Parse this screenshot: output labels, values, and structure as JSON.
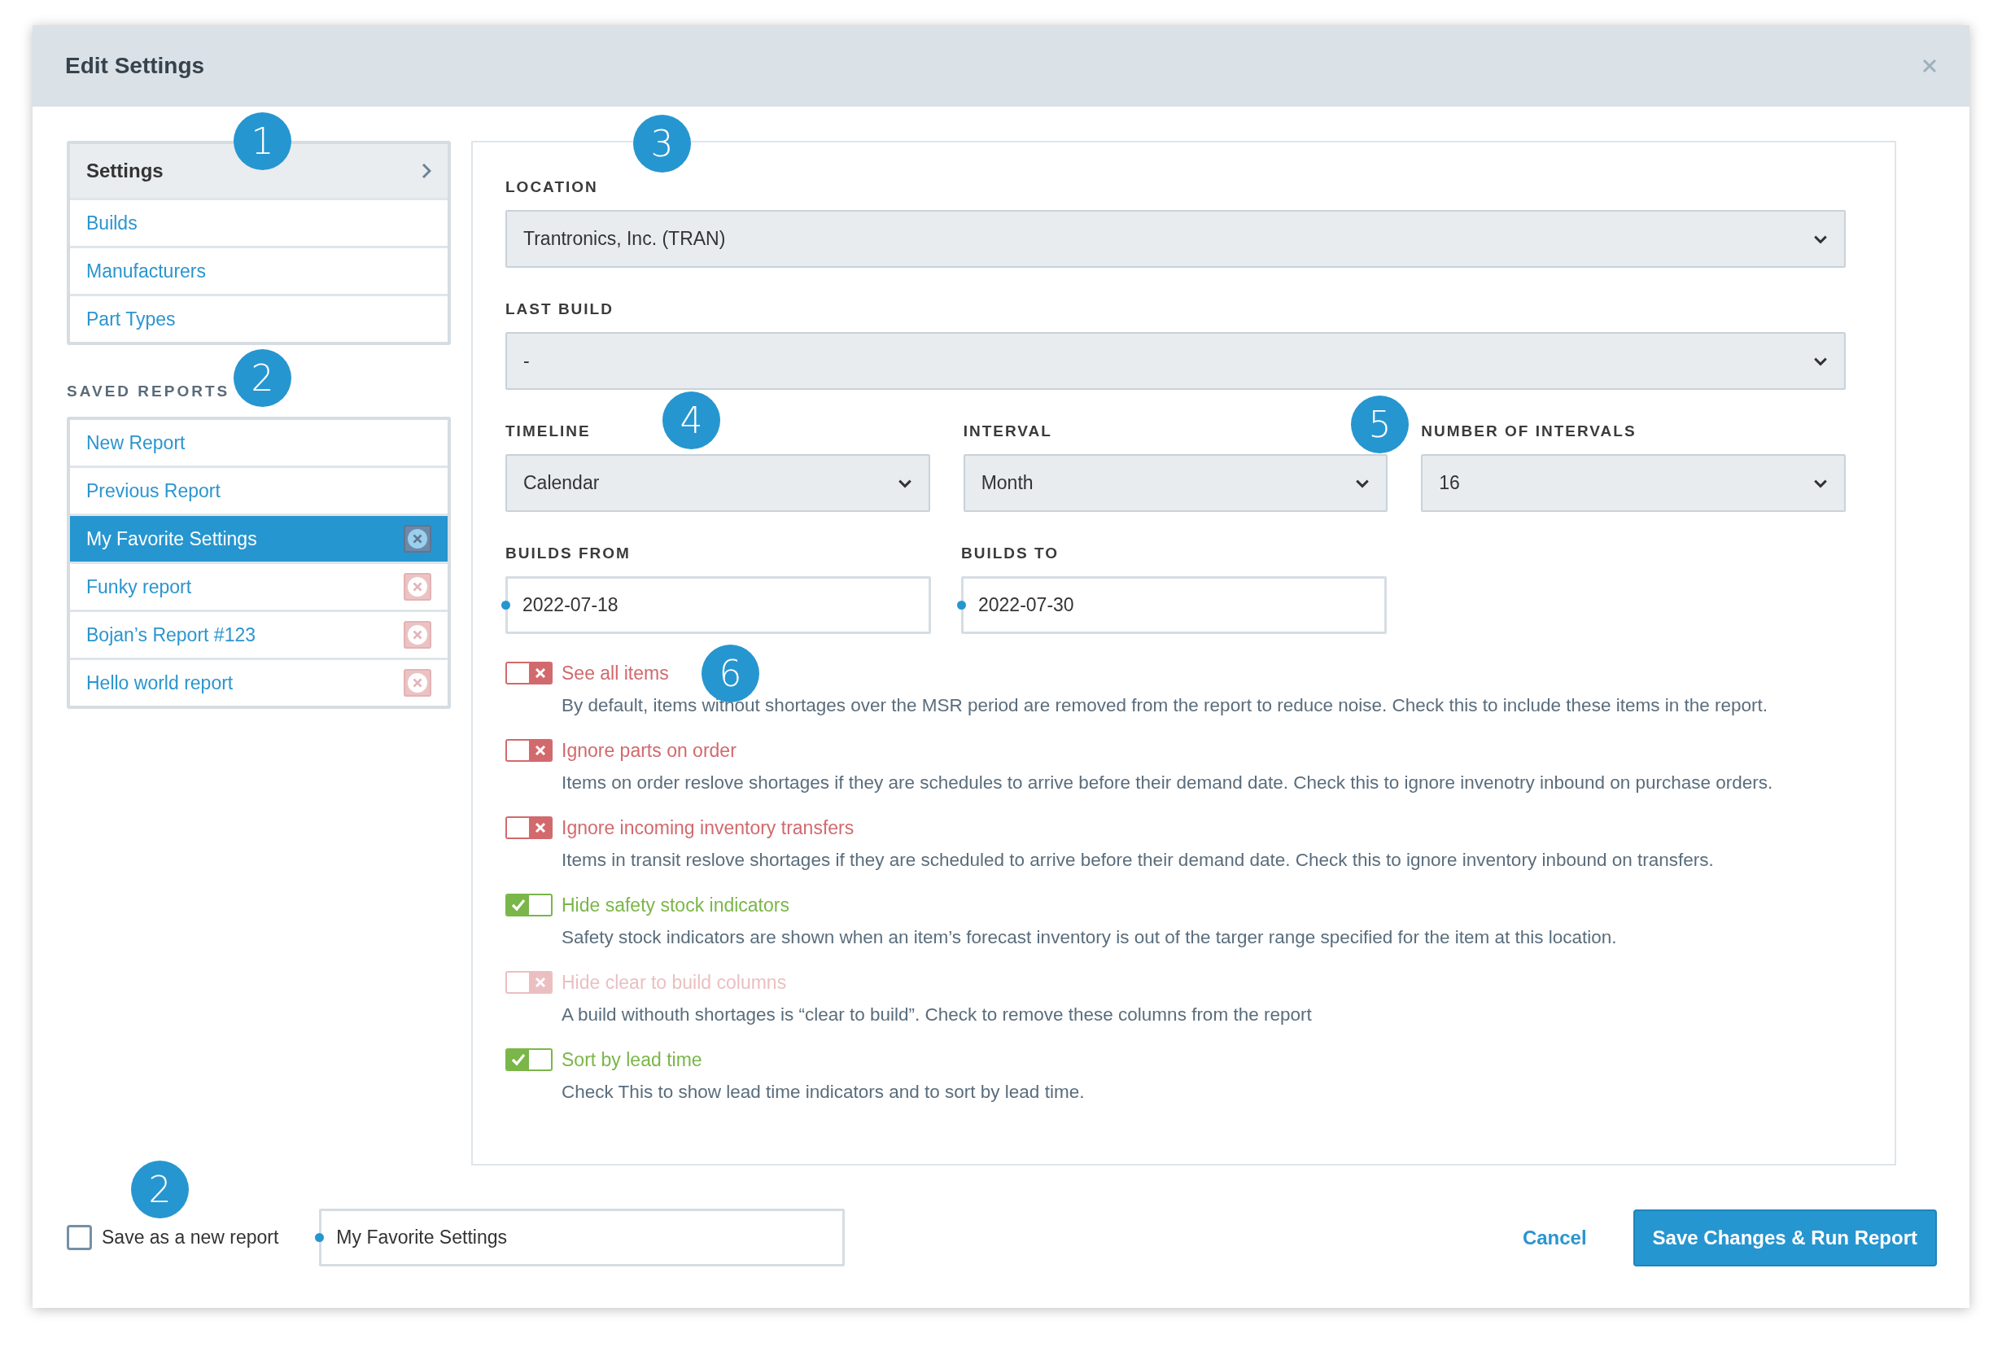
{
  "dialog": {
    "title": "Edit Settings"
  },
  "settings_menu": {
    "header": "Settings",
    "items": [
      {
        "label": "Builds"
      },
      {
        "label": "Manufacturers"
      },
      {
        "label": "Part Types"
      }
    ]
  },
  "saved_reports": {
    "title": "SAVED REPORTS",
    "items": [
      {
        "label": "New Report",
        "selected": false,
        "deletable": false
      },
      {
        "label": "Previous Report",
        "selected": false,
        "deletable": false
      },
      {
        "label": "My Favorite Settings",
        "selected": true,
        "deletable": true
      },
      {
        "label": "Funky report",
        "selected": false,
        "deletable": true
      },
      {
        "label": "Bojan’s Report #123",
        "selected": false,
        "deletable": true
      },
      {
        "label": "Hello world report",
        "selected": false,
        "deletable": true
      }
    ]
  },
  "location": {
    "label": "LOCATION",
    "value": "Trantronics, Inc. (TRAN)"
  },
  "last_build": {
    "label": "LAST BUILD",
    "value": "-"
  },
  "selects": [
    {
      "label": "TIMELINE",
      "value": "Calendar"
    },
    {
      "label": "INTERVAL",
      "value": "Month"
    },
    {
      "label": "NUMBER OF INTERVALS",
      "value": "16"
    }
  ],
  "dates": [
    {
      "label": "BUILDS FROM",
      "value": "2022-07-18"
    },
    {
      "label": "BUILDS TO",
      "value": "2022-07-30"
    }
  ],
  "options": [
    {
      "label": "See all items",
      "description": "By default, items without shortages over the MSR period are removed from the report to reduce noise. Check this to include these items in the report.",
      "checked": false,
      "disabled": false
    },
    {
      "label": "Ignore parts on order",
      "description": "Items on order reslove shortages if they are schedules to arrive before their demand date. Check this to ignore invenotry inbound on purchase orders.",
      "checked": false,
      "disabled": false
    },
    {
      "label": "Ignore incoming inventory transfers",
      "description": "Items in transit reslove shortages if they are scheduled to arrive before their demand date. Check this to ignore inventory inbound on transfers.",
      "checked": false,
      "disabled": false
    },
    {
      "label": "Hide safety stock indicators",
      "description": "Safety stock indicators are shown when an item’s forecast inventory is out of the targer range specified for the item at this location.",
      "checked": true,
      "disabled": false
    },
    {
      "label": "Hide clear to build columns",
      "description": "A build withouth shortages is “clear to build”. Check to remove these columns from the report",
      "checked": false,
      "disabled": true
    },
    {
      "label": "Sort by lead time",
      "description": "Check This to show lead time indicators and to sort by lead time.",
      "checked": true,
      "disabled": false
    }
  ],
  "footer": {
    "save_as_new": {
      "label": "Save as a new report",
      "checked": false
    },
    "report_name": {
      "value": "My Favorite Settings"
    },
    "cancel": "Cancel",
    "submit": "Save Changes & Run Report"
  },
  "callouts": [
    "1",
    "2",
    "3",
    "4",
    "5",
    "6",
    "2"
  ]
}
